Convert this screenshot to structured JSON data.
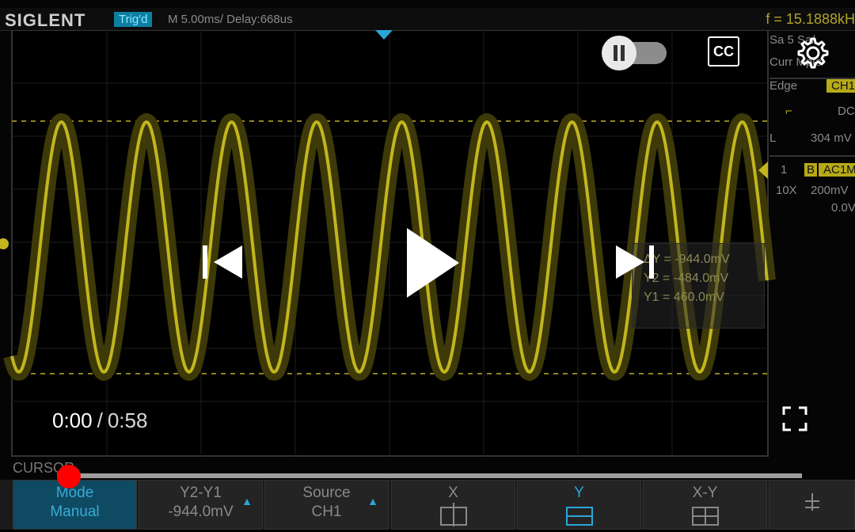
{
  "scope": {
    "brand": "SIGLENT",
    "trigger_status": "Trig'd",
    "timebase": "M 5.00ms/ Delay:668us",
    "frequency": "f = 15.1888kH",
    "side": {
      "sample_rate": "Sa 5",
      "sample_rate_unit": "Sa/",
      "curr": "Curr",
      "mpts": "Mpts",
      "trigger_type": "Edge",
      "trigger_channel": "CH1",
      "coupling": "DC",
      "level_label": "L",
      "level_value": "304 mV",
      "channel_num": "1",
      "channel_b": "B",
      "channel_mode": "AC1M",
      "probe": "10X",
      "volts_div": "200mV",
      "offset": "0.0V"
    },
    "cursor_readout": {
      "dy": "ΔY = -944.0mV",
      "y2": "Y2 = -484.0mV",
      "y1": "Y1 = 460.0mV"
    },
    "menu_title": "CURSOR",
    "menu": [
      {
        "label": "Mode",
        "value": "Manual"
      },
      {
        "label": "Y2-Y1",
        "value": "-944.0mV"
      },
      {
        "label": "Source",
        "value": "CH1"
      },
      {
        "label": "X",
        "value": ""
      },
      {
        "label": "Y",
        "value": ""
      },
      {
        "label": "X-Y",
        "value": ""
      }
    ],
    "colors": {
      "trace": "#c2b51e",
      "accent": "#2aa6d6"
    }
  },
  "player": {
    "current_time": "0:00",
    "separator": "/",
    "duration": "0:58",
    "progress_fraction": 0,
    "autoplay_toggle": "on",
    "cc_label": "CC",
    "icons": [
      "pause-icon",
      "cc-icon",
      "gear-icon",
      "skip-previous-icon",
      "play-icon",
      "skip-next-icon",
      "fullscreen-icon"
    ]
  }
}
